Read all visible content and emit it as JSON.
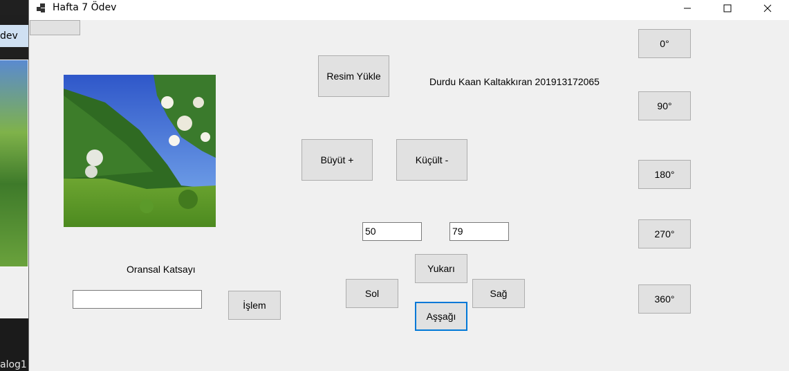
{
  "background": {
    "tab_label": "dev",
    "bottom_text": "alog1"
  },
  "window": {
    "title": "Hafta 7 Ödev",
    "buttons": {
      "load_image": "Resim Yükle",
      "enlarge": "Büyüt +",
      "shrink": "Küçült -",
      "rotate_0": "0°",
      "rotate_90": "90°",
      "rotate_180": "180°",
      "rotate_270": "270°",
      "rotate_360": "360°",
      "up": "Yukarı",
      "left": "Sol",
      "right": "Sağ",
      "down": "Aşşağı",
      "process": "İşlem",
      "top_blank": ""
    },
    "author_label": "Durdu Kaan Kaltakkıran 201913172065",
    "ratio_label": "Oransal Katsayı",
    "inputs": {
      "width_value": "50",
      "height_value": "79",
      "ratio_value": ""
    },
    "accent_color": "#0078d7"
  }
}
